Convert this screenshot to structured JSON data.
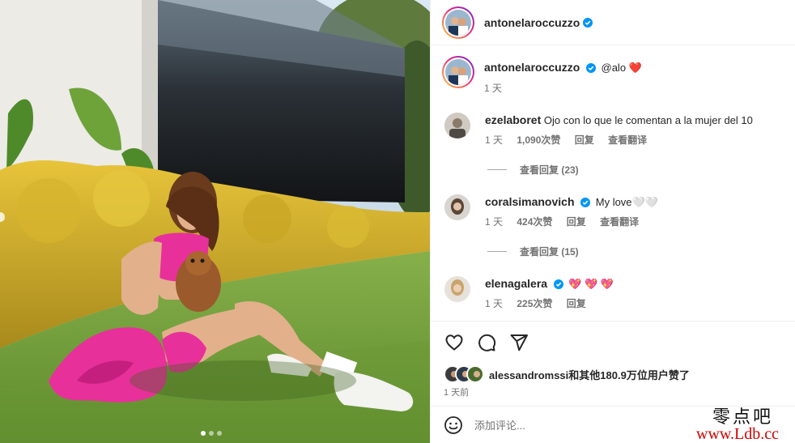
{
  "post": {
    "author": "antonelaroccuzzo",
    "caption_mention": "@alo",
    "caption_emoji": "❤️",
    "caption_time": "1 天"
  },
  "comments": [
    {
      "user": "ezelaboret",
      "verified": false,
      "text": "Ojo con lo que le comentan a la mujer del 10",
      "time": "1 天",
      "likes": "1,090次赞",
      "reply": "回复",
      "translate": "查看翻译",
      "view_replies": "查看回复 (23)"
    },
    {
      "user": "coralsimanovich",
      "verified": true,
      "text": "My love🤍🤍",
      "time": "1 天",
      "likes": "424次赞",
      "reply": "回复",
      "translate": "查看翻译",
      "view_replies": "查看回复 (15)"
    },
    {
      "user": "elenagalera",
      "verified": true,
      "text": "💖 💖 💖",
      "time": "1 天",
      "likes": "225次赞",
      "reply": "回复"
    }
  ],
  "likes": {
    "first_user": "alessandromssi",
    "rest": "和其他180.9万位用户赞了"
  },
  "post_date": "1 天前",
  "add_comment": {
    "placeholder": "添加评论..."
  },
  "watermark": {
    "line1": "零点吧",
    "line2": "www.Ldb.cc"
  },
  "icons": {
    "like": "heart-icon",
    "comment": "comment-icon",
    "share": "share-icon",
    "emoji": "emoji-icon",
    "verified": "verified-badge-icon"
  },
  "colors": {
    "verified": "#0095f6",
    "heart": "#ed4956",
    "muted": "#737373",
    "outfit": "#e8309a"
  },
  "carousel": {
    "total": 3,
    "active": 1
  }
}
